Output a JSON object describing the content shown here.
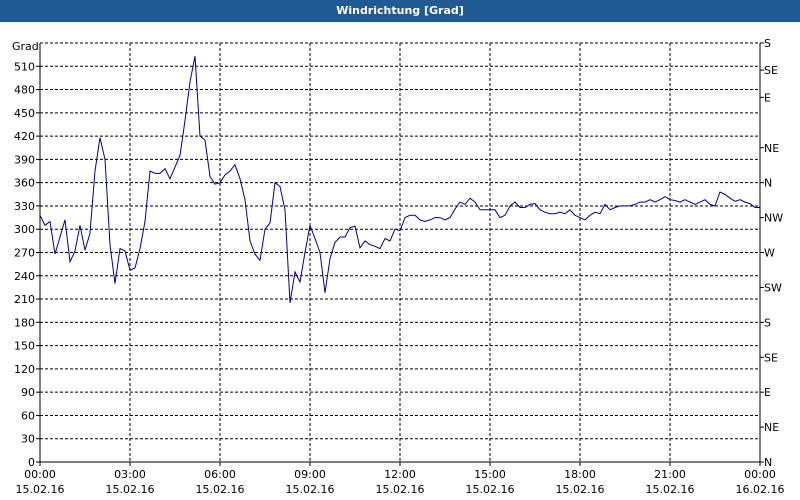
{
  "window": {
    "title": "Windrichtung [Grad]"
  },
  "chart_data": {
    "type": "line",
    "title": "Windrichtung [Grad]",
    "ylabel": "Grad",
    "ylim": [
      0,
      540
    ],
    "grid": true,
    "y_ticks": [
      0,
      30,
      60,
      90,
      120,
      150,
      180,
      210,
      240,
      270,
      300,
      330,
      360,
      390,
      420,
      450,
      480,
      510
    ],
    "right_ticks": [
      {
        "value": 540,
        "label": "S"
      },
      {
        "value": 505,
        "label": "SE"
      },
      {
        "value": 470,
        "label": "E"
      },
      {
        "value": 405,
        "label": "NE"
      },
      {
        "value": 360,
        "label": "N"
      },
      {
        "value": 315,
        "label": "NW"
      },
      {
        "value": 270,
        "label": "W"
      },
      {
        "value": 225,
        "label": "SW"
      },
      {
        "value": 180,
        "label": "S"
      },
      {
        "value": 135,
        "label": "SE"
      },
      {
        "value": 90,
        "label": "E"
      },
      {
        "value": 45,
        "label": "NE"
      },
      {
        "value": 0,
        "label": "N"
      }
    ],
    "x_ticks": [
      {
        "time": "00:00",
        "date": "15.02.16"
      },
      {
        "time": "03:00",
        "date": "15.02.16"
      },
      {
        "time": "06:00",
        "date": "15.02.16"
      },
      {
        "time": "09:00",
        "date": "15.02.16"
      },
      {
        "time": "12:00",
        "date": "15.02.16"
      },
      {
        "time": "15:00",
        "date": "15.02.16"
      },
      {
        "time": "18:00",
        "date": "15.02.16"
      },
      {
        "time": "21:00",
        "date": "15.02.16"
      },
      {
        "time": "00:00",
        "date": "16.02.16"
      }
    ],
    "xlim": [
      "15.02.16 00:00",
      "16.02.16 00:00"
    ],
    "series": [
      {
        "color": "#00008b",
        "points": [
          [
            "00:00",
            318
          ],
          [
            "00:10",
            305
          ],
          [
            "00:20",
            310
          ],
          [
            "00:30",
            268
          ],
          [
            "00:40",
            290
          ],
          [
            "00:50",
            312
          ],
          [
            "01:00",
            258
          ],
          [
            "01:10",
            272
          ],
          [
            "01:20",
            305
          ],
          [
            "01:30",
            273
          ],
          [
            "01:40",
            295
          ],
          [
            "01:50",
            375
          ],
          [
            "02:00",
            418
          ],
          [
            "02:10",
            390
          ],
          [
            "02:20",
            280
          ],
          [
            "02:30",
            230
          ],
          [
            "02:40",
            275
          ],
          [
            "02:50",
            272
          ],
          [
            "03:00",
            247
          ],
          [
            "03:10",
            250
          ],
          [
            "03:20",
            275
          ],
          [
            "03:30",
            310
          ],
          [
            "03:40",
            375
          ],
          [
            "03:50",
            372
          ],
          [
            "04:00",
            372
          ],
          [
            "04:10",
            378
          ],
          [
            "04:20",
            365
          ],
          [
            "04:30",
            380
          ],
          [
            "04:40",
            395
          ],
          [
            "04:50",
            440
          ],
          [
            "05:00",
            490
          ],
          [
            "05:10",
            523
          ],
          [
            "05:20",
            420
          ],
          [
            "05:30",
            415
          ],
          [
            "05:40",
            368
          ],
          [
            "05:50",
            358
          ],
          [
            "06:00",
            360
          ],
          [
            "06:10",
            370
          ],
          [
            "06:20",
            375
          ],
          [
            "06:30",
            383
          ],
          [
            "06:40",
            365
          ],
          [
            "06:50",
            338
          ],
          [
            "07:00",
            285
          ],
          [
            "07:10",
            268
          ],
          [
            "07:20",
            260
          ],
          [
            "07:30",
            300
          ],
          [
            "07:40",
            308
          ],
          [
            "07:50",
            360
          ],
          [
            "08:00",
            355
          ],
          [
            "08:10",
            325
          ],
          [
            "08:20",
            205
          ],
          [
            "08:30",
            245
          ],
          [
            "08:40",
            232
          ],
          [
            "08:50",
            270
          ],
          [
            "09:00",
            305
          ],
          [
            "09:10",
            288
          ],
          [
            "09:20",
            270
          ],
          [
            "09:30",
            218
          ],
          [
            "09:40",
            262
          ],
          [
            "09:50",
            283
          ],
          [
            "10:00",
            290
          ],
          [
            "10:10",
            290
          ],
          [
            "10:20",
            302
          ],
          [
            "10:30",
            304
          ],
          [
            "10:40",
            276
          ],
          [
            "10:50",
            285
          ],
          [
            "11:00",
            280
          ],
          [
            "11:10",
            278
          ],
          [
            "11:20",
            275
          ],
          [
            "11:30",
            288
          ],
          [
            "11:40",
            285
          ],
          [
            "11:50",
            300
          ],
          [
            "12:00",
            298
          ],
          [
            "12:10",
            315
          ],
          [
            "12:20",
            318
          ],
          [
            "12:30",
            318
          ],
          [
            "12:40",
            312
          ],
          [
            "12:50",
            310
          ],
          [
            "13:00",
            312
          ],
          [
            "13:10",
            315
          ],
          [
            "13:20",
            315
          ],
          [
            "13:30",
            312
          ],
          [
            "13:40",
            315
          ],
          [
            "13:50",
            326
          ],
          [
            "14:00",
            335
          ],
          [
            "14:10",
            332
          ],
          [
            "14:20",
            340
          ],
          [
            "14:30",
            335
          ],
          [
            "14:40",
            325
          ],
          [
            "14:50",
            325
          ],
          [
            "15:00",
            325
          ],
          [
            "15:10",
            325
          ],
          [
            "15:20",
            315
          ],
          [
            "15:30",
            318
          ],
          [
            "15:40",
            330
          ],
          [
            "15:50",
            335
          ],
          [
            "16:00",
            328
          ],
          [
            "16:10",
            328
          ],
          [
            "16:20",
            332
          ],
          [
            "16:30",
            333
          ],
          [
            "16:40",
            325
          ],
          [
            "16:50",
            322
          ],
          [
            "17:00",
            320
          ],
          [
            "17:10",
            320
          ],
          [
            "17:20",
            322
          ],
          [
            "17:30",
            320
          ],
          [
            "17:40",
            325
          ],
          [
            "17:50",
            318
          ],
          [
            "18:00",
            315
          ],
          [
            "18:10",
            312
          ],
          [
            "18:20",
            318
          ],
          [
            "18:30",
            322
          ],
          [
            "18:40",
            320
          ],
          [
            "18:50",
            332
          ],
          [
            "19:00",
            325
          ],
          [
            "19:10",
            328
          ],
          [
            "19:20",
            330
          ],
          [
            "19:30",
            330
          ],
          [
            "19:40",
            330
          ],
          [
            "19:50",
            332
          ],
          [
            "20:00",
            335
          ],
          [
            "20:10",
            335
          ],
          [
            "20:20",
            338
          ],
          [
            "20:30",
            335
          ],
          [
            "20:40",
            338
          ],
          [
            "20:50",
            342
          ],
          [
            "21:00",
            338
          ],
          [
            "21:10",
            337
          ],
          [
            "21:20",
            335
          ],
          [
            "21:30",
            338
          ],
          [
            "21:40",
            335
          ],
          [
            "21:50",
            332
          ],
          [
            "22:00",
            335
          ],
          [
            "22:10",
            338
          ],
          [
            "22:20",
            332
          ],
          [
            "22:30",
            330
          ],
          [
            "22:40",
            348
          ],
          [
            "22:50",
            345
          ],
          [
            "23:00",
            340
          ],
          [
            "23:10",
            336
          ],
          [
            "23:20",
            338
          ],
          [
            "23:30",
            335
          ],
          [
            "23:40",
            333
          ],
          [
            "23:50",
            328
          ],
          [
            "24:00",
            328
          ]
        ]
      }
    ]
  }
}
